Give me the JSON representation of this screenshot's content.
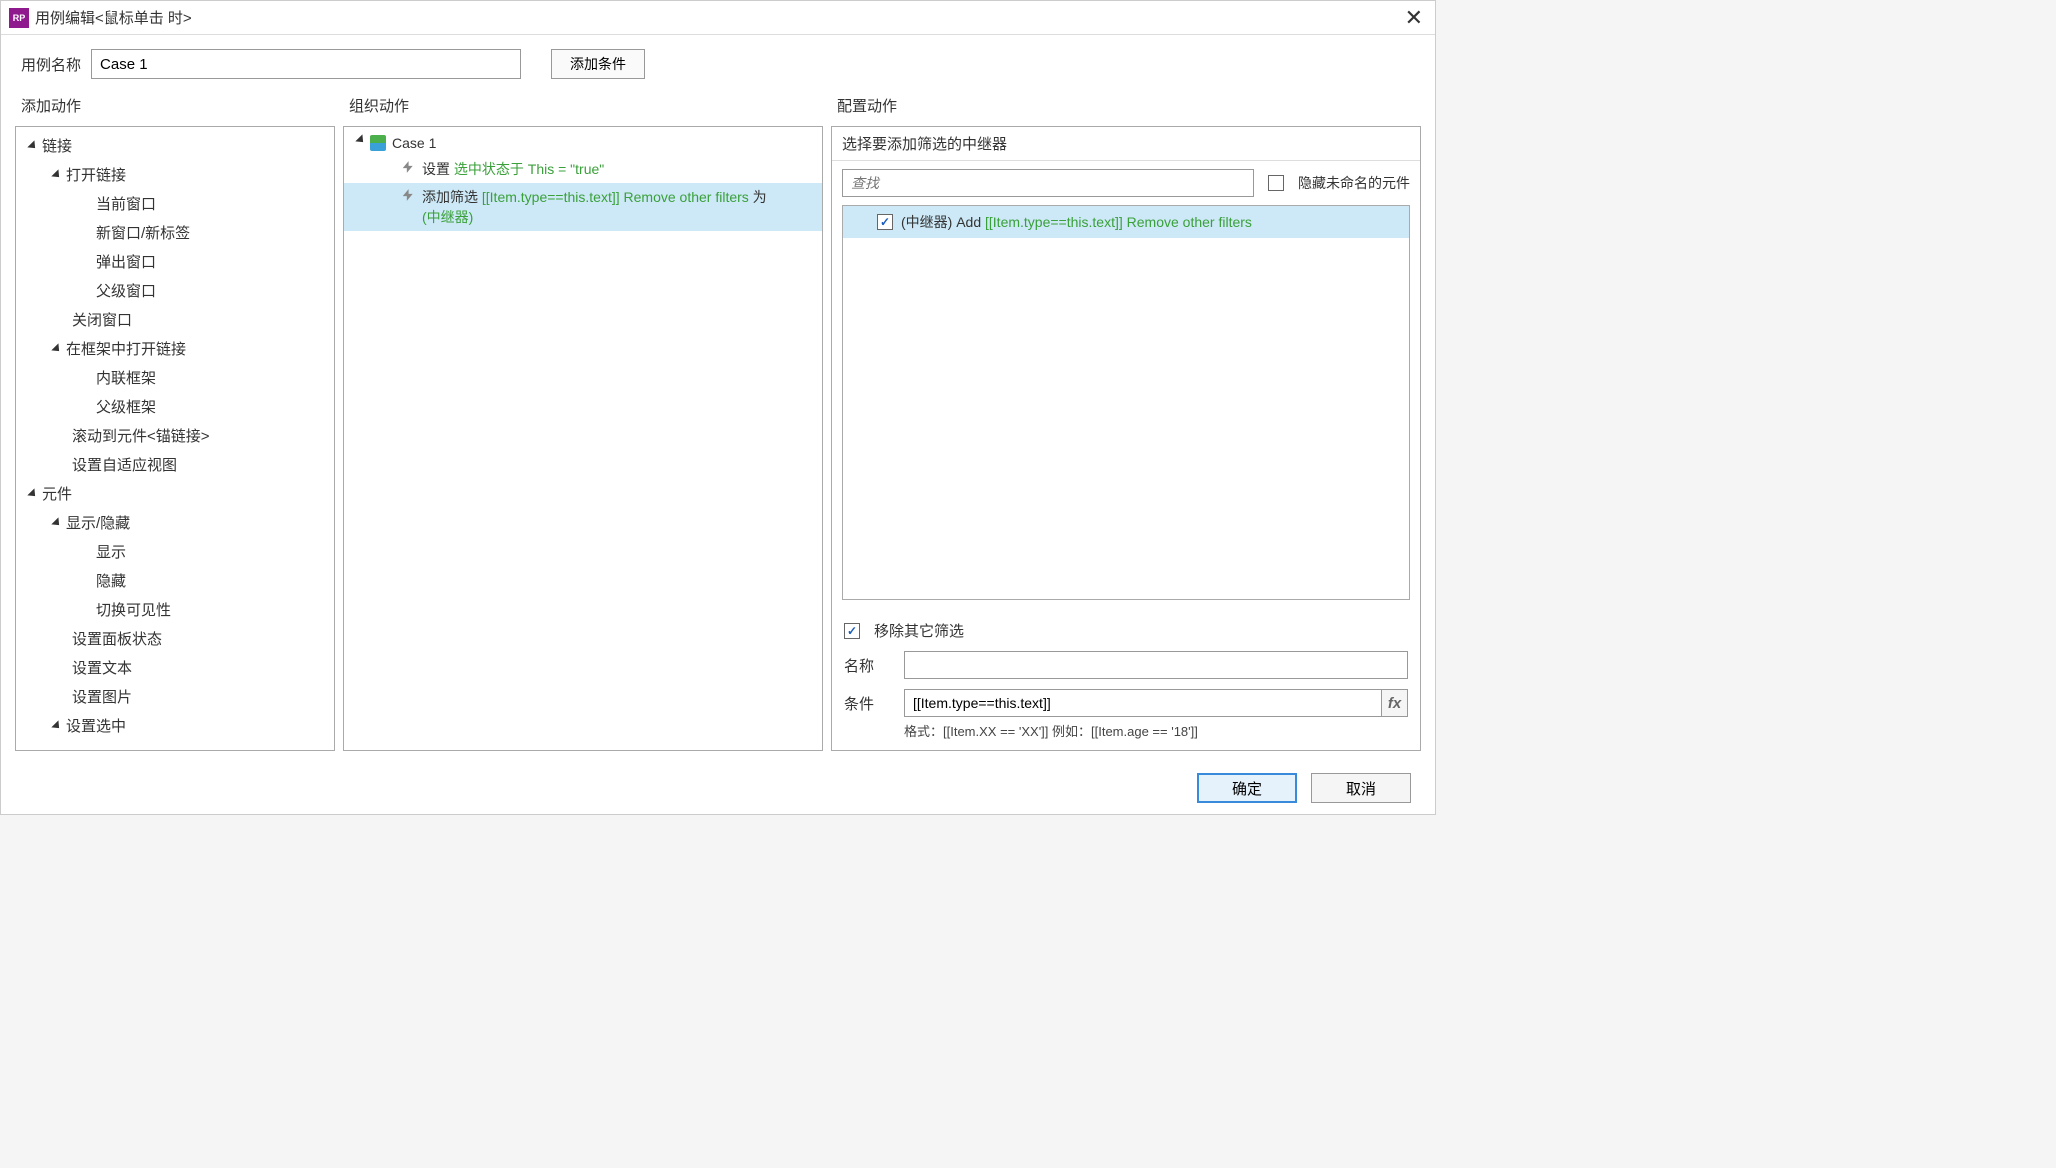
{
  "titlebar": {
    "app_icon_text": "RP",
    "title": "用例编辑<鼠标单击 时>"
  },
  "toprow": {
    "case_name_label": "用例名称",
    "case_name_value": "Case 1",
    "add_condition_label": "添加条件"
  },
  "columns": {
    "add_action_header": "添加动作",
    "organize_header": "组织动作",
    "configure_header": "配置动作"
  },
  "action_tree": {
    "links": {
      "label": "链接",
      "open_link": "打开链接",
      "current_window": "当前窗口",
      "new_window": "新窗口/新标签",
      "popup": "弹出窗口",
      "parent_window": "父级窗口",
      "close_window": "关闭窗口",
      "open_in_frame": "在框架中打开链接",
      "iframe": "内联框架",
      "parent_frame": "父级框架",
      "scroll_anchor": "滚动到元件<锚链接>",
      "adaptive_view": "设置自适应视图"
    },
    "widgets": {
      "label": "元件",
      "show_hide": "显示/隐藏",
      "show": "显示",
      "hide": "隐藏",
      "toggle_vis": "切换可见性",
      "panel_state": "设置面板状态",
      "set_text": "设置文本",
      "set_image": "设置图片",
      "set_selected": "设置选中"
    }
  },
  "organize": {
    "case_label": "Case 1",
    "action1_prefix": "设置 ",
    "action1_green": "选中状态于 This = \"true\"",
    "action2_prefix": "添加筛选 ",
    "action2_green1": "[[Item.type==this.text]] Remove other filters",
    "action2_mid": " 为 ",
    "action2_green2": "(中继器)"
  },
  "configure": {
    "title": "选择要添加筛选的中继器",
    "search_placeholder": "查找",
    "hide_unnamed_label": "隐藏未命名的元件",
    "target_prefix": "(中继器) Add ",
    "target_green": "[[Item.type==this.text]] Remove other filters",
    "remove_other_label": "移除其它筛选",
    "name_label": "名称",
    "name_value": "",
    "condition_label": "条件",
    "condition_value": "[[Item.type==this.text]]",
    "fx_label": "fx",
    "hint": "格式：[[Item.XX == 'XX']] 例如：[[Item.age == '18']]"
  },
  "footer": {
    "ok": "确定",
    "cancel": "取消"
  }
}
